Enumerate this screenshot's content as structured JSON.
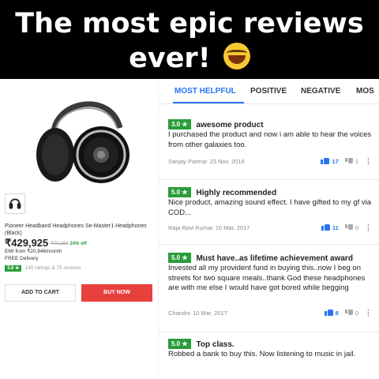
{
  "meme": {
    "caption_line1": "The most epic reviews",
    "caption_line2": "ever!",
    "emoji": "laughing-tears-emoji"
  },
  "product": {
    "name": "Pioneer Headband Headphones Se-Master1 Headphones (Black)",
    "price": "₹429,925",
    "mrp": "₹70,284",
    "discount": "24% off",
    "emi": "EMI from ₹20,846/month",
    "delivery": "FREE Delivery",
    "rating": "3.8 ★",
    "rating_count": "140 ratings & 75 reviews",
    "add_to_cart": "ADD TO CART",
    "buy_now": "BUY NOW"
  },
  "tabs": [
    "MOST HELPFUL",
    "POSITIVE",
    "NEGATIVE",
    "MOS"
  ],
  "reviews": [
    {
      "rating": "3.0 ★",
      "title": "awesome product",
      "body": "I purchased the product and now i am able to hear the voices from other galaxies too.",
      "author": "Sanjay Parmar",
      "date": "23 Nov, 2016",
      "up": "17",
      "down": "1"
    },
    {
      "rating": "5.0 ★",
      "title": "Highly recommended",
      "body": "Nice product, amazing sound effect. I have gifted to my gf via COD...",
      "author": "Raja Ravi Kumar",
      "date": "10 Mar, 2017",
      "up": "11",
      "down": "0"
    },
    {
      "rating": "5.0 ★",
      "title": "Must have..as lifetime achievement award",
      "body": "Invested all my provident fund in buying this..now I beg on streets for two square meals..thank God these headphones are with me else I would have got bored while begging",
      "author": "Chandni",
      "date": "10 Mar, 2017",
      "up": "8",
      "down": "0"
    },
    {
      "rating": "5.0 ★",
      "title": "Top class.",
      "body": "Robbed a bank to buy this. Now listening to music in jail.",
      "author": "",
      "date": "",
      "up": "",
      "down": ""
    }
  ],
  "colors": {
    "accent_blue": "#2874f0",
    "rating_green": "#2a9d3a",
    "buy_red": "#e8403d"
  }
}
